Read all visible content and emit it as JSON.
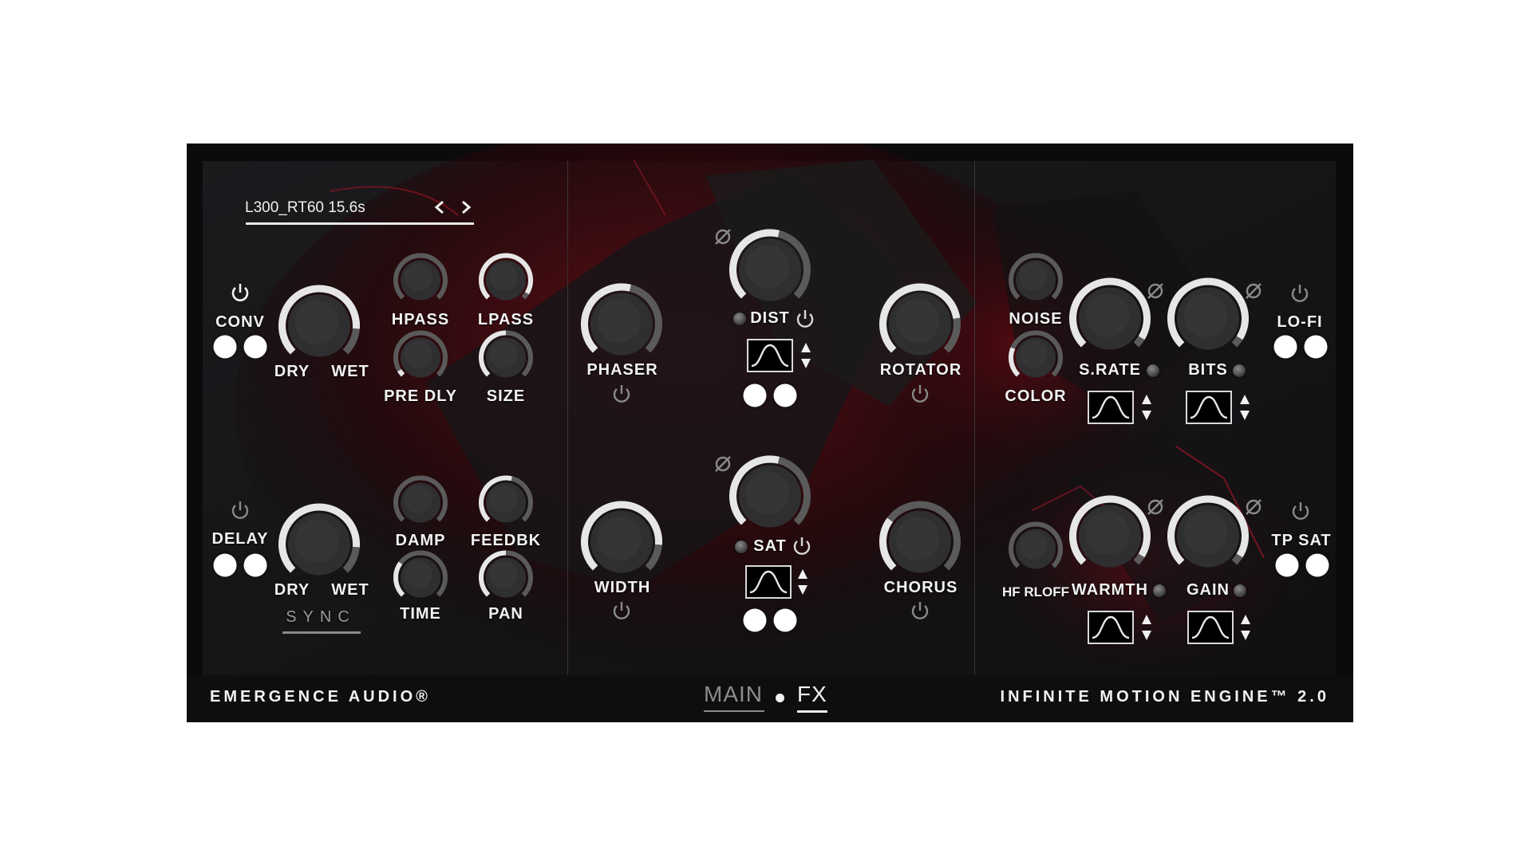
{
  "colors": {
    "accent": "#b01020",
    "panel": "#0b0b0d",
    "text": "#f2f2f2",
    "knob_track": "#5a5a5a",
    "knob_fill": "#e6e6e6"
  },
  "reverb": {
    "preset": "L300_RT60 15.6s",
    "prev_icon": "chevron-left-icon",
    "next_icon": "chevron-right-icon",
    "conv_label": "CONV",
    "dry_label": "DRY",
    "wet_label": "WET",
    "hpass_label": "HPASS",
    "lpass_label": "LPASS",
    "predly_label": "PRE DLY",
    "size_label": "SIZE"
  },
  "delay": {
    "delay_label": "DELAY",
    "dry_label": "DRY",
    "wet_label": "WET",
    "damp_label": "DAMP",
    "feedbk_label": "FEEDBK",
    "time_label": "TIME",
    "pan_label": "PAN",
    "sync_label": "SYNC"
  },
  "modulation": {
    "phaser_label": "PHASER",
    "dist_label": "DIST",
    "rotator_label": "ROTATOR",
    "width_label": "WIDTH",
    "sat_label": "SAT",
    "chorus_label": "CHORUS"
  },
  "lofi": {
    "noise_label": "NOISE",
    "color_label": "COLOR",
    "srate_label": "S.RATE",
    "bits_label": "BITS",
    "lofi_label": "LO-FI"
  },
  "tpsat": {
    "hfrloff_label": "HF RLOFF",
    "warmth_label": "WARMTH",
    "gain_label": "GAIN",
    "tpsat_label": "TP SAT"
  },
  "knob_levels": {
    "conv_mix": 0.85,
    "hpass": 0.0,
    "lpass": 0.95,
    "pre_dly": 0.05,
    "size": 0.5,
    "delay_mix": 0.85,
    "damp": 0.0,
    "feedbk": 0.55,
    "time": 0.3,
    "pan": 0.5,
    "phaser": 0.55,
    "dist": 0.55,
    "rotator": 0.8,
    "width": 0.85,
    "sat": 0.55,
    "chorus": 0.3,
    "noise": 0.0,
    "color": 0.25,
    "s_rate": 0.95,
    "bits": 0.95,
    "hf_rloff": 0.0,
    "warmth": 0.95,
    "gain": 0.95
  },
  "footer": {
    "brand": "EMERGENCE AUDIO®",
    "tab_main": "MAIN",
    "tab_fx": "FX",
    "product": "INFINITE MOTION ENGINE™ 2.0"
  }
}
